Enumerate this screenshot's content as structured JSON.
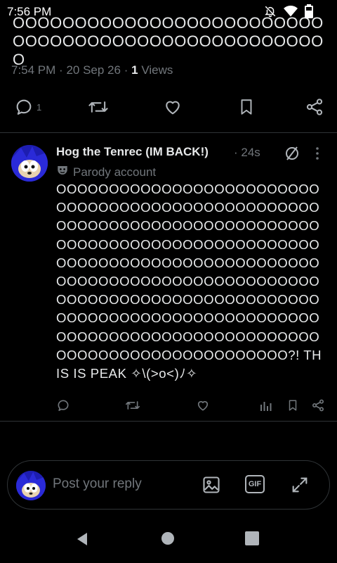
{
  "status_bar": {
    "time": "7:56 PM",
    "icons": [
      "notifications-off-icon",
      "wifi-icon",
      "battery-icon"
    ]
  },
  "main_post": {
    "text_tail": "OOOOOOOOOOOOOOOOOOOOOOOOOOOOOOOOOOOOOOOOOOOOOOOOOOO",
    "time": "7:54 PM",
    "separator": "·",
    "date": "20 Sep 26",
    "views_count": "1",
    "views_label": "Views",
    "actions": {
      "reply_count": "1",
      "icons": [
        "reply-icon",
        "repost-icon",
        "like-icon",
        "bookmark-icon",
        "share-icon"
      ]
    }
  },
  "reply": {
    "display_name": "Hog the Tenrec (IM BACK!)",
    "time": "· 24s",
    "parody_label": "Parody account",
    "text": "OOOOOOOOOOOOOOOOOOOOOOOOOOOOOOOOOOOOOOOOOOOOOOOOOOOOOOOOOOOOOOOOOOOOOOOOOOOOOOOOOOOOOOOOOOOOOOOOOOOOOOOOOOOOOOOOOOOOOOOOOOOOOOOOOOOOOOOOOOOOOOOOOOOOOOOOOOOOOOOOOOOOOOOOOOOOOOOOOOOOOOOOOOOOOOOOOOOOOOOOOOOOOOOOOOOOOOOOOOOOOOOOOOOOOOOOOOOOOOOOOOOOOOO?! THIS IS PEAK ✧\\(>o<)ﾉ✧",
    "actions": [
      "reply-icon",
      "repost-icon",
      "like-icon",
      "views-icon",
      "bookmark-icon",
      "share-icon"
    ]
  },
  "composer": {
    "placeholder": "Post your reply",
    "tools": [
      "image-icon",
      "gif-icon",
      "expand-icon"
    ],
    "gif_label": "GIF"
  },
  "navbar": {
    "buttons": [
      "back-icon",
      "home-icon",
      "recents-icon"
    ]
  },
  "colors": {
    "background": "#000000",
    "text": "#e7e9ea",
    "muted": "#71767b",
    "divider": "#2f3336",
    "avatar_blue": "#1a1aa0"
  }
}
